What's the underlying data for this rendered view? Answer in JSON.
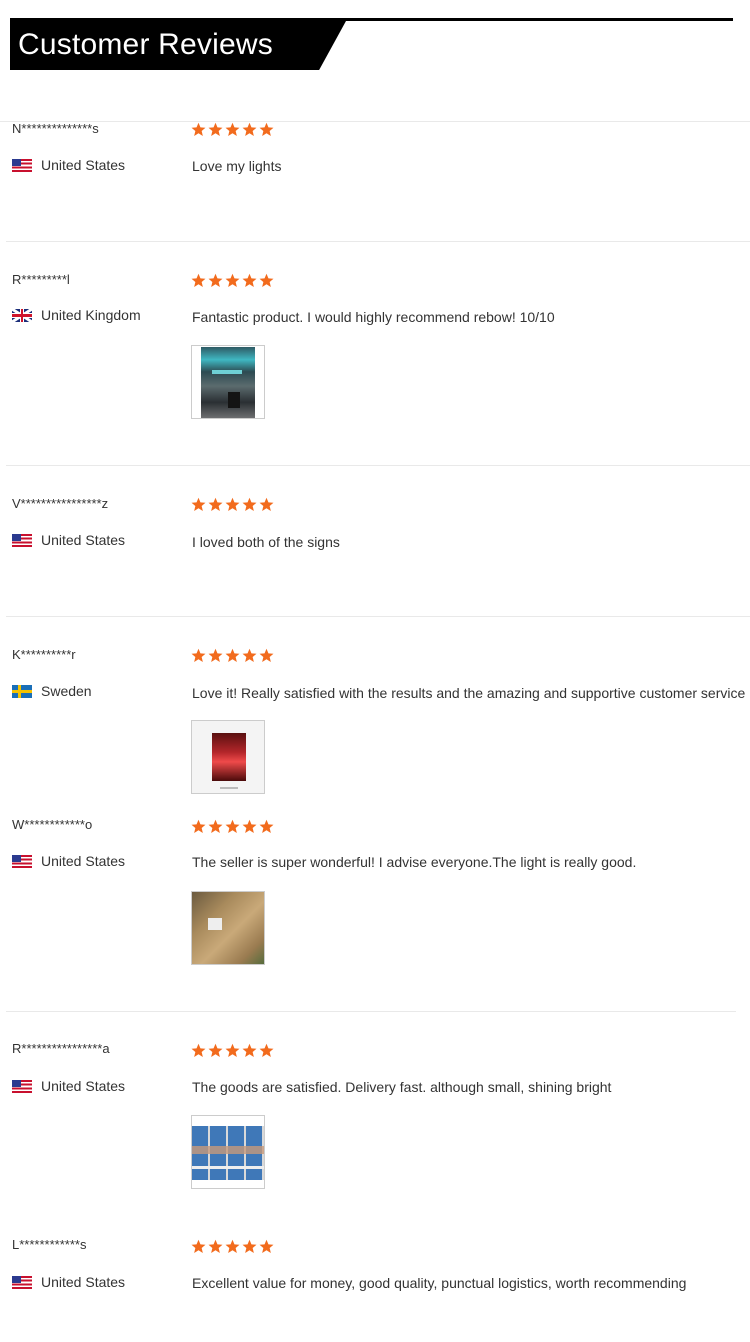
{
  "header": {
    "title": "Customer Reviews"
  },
  "colors": {
    "star": "#f26b1d",
    "banner": "#000000",
    "text": "#333333",
    "divider": "#e9e9e9"
  },
  "reviews": [
    {
      "name": "N**************s",
      "country": "United States",
      "flag": "us-flag-icon",
      "rating": 5,
      "text": "Love my lights",
      "has_photo": false
    },
    {
      "name": "R*********l",
      "country": "United Kingdom",
      "flag": "uk-flag-icon",
      "rating": 5,
      "text": "Fantastic product. I would highly recommend rebow! 10/10",
      "has_photo": true
    },
    {
      "name": "V****************z",
      "country": "United States",
      "flag": "us-flag-icon",
      "rating": 5,
      "text": "I loved both of the signs",
      "has_photo": false
    },
    {
      "name": "K**********r",
      "country": "Sweden",
      "flag": "sweden-flag-icon",
      "rating": 5,
      "text": "Love it! Really satisfied with the results and the amazing and supportive customer service",
      "has_photo": true
    },
    {
      "name": "W************o",
      "country": "United States",
      "flag": "us-flag-icon",
      "rating": 5,
      "text": "The seller is super wonderful! I advise everyone.The light is really good.",
      "has_photo": true
    },
    {
      "name": "R****************a",
      "country": "United States",
      "flag": "us-flag-icon",
      "rating": 5,
      "text": "The goods are satisfied. Delivery fast. although small, shining bright",
      "has_photo": true
    },
    {
      "name": "L************s",
      "country": "United States",
      "flag": "us-flag-icon",
      "rating": 5,
      "text": "Excellent value for money, good quality, punctual logistics, worth recommending",
      "has_photo": false
    }
  ]
}
